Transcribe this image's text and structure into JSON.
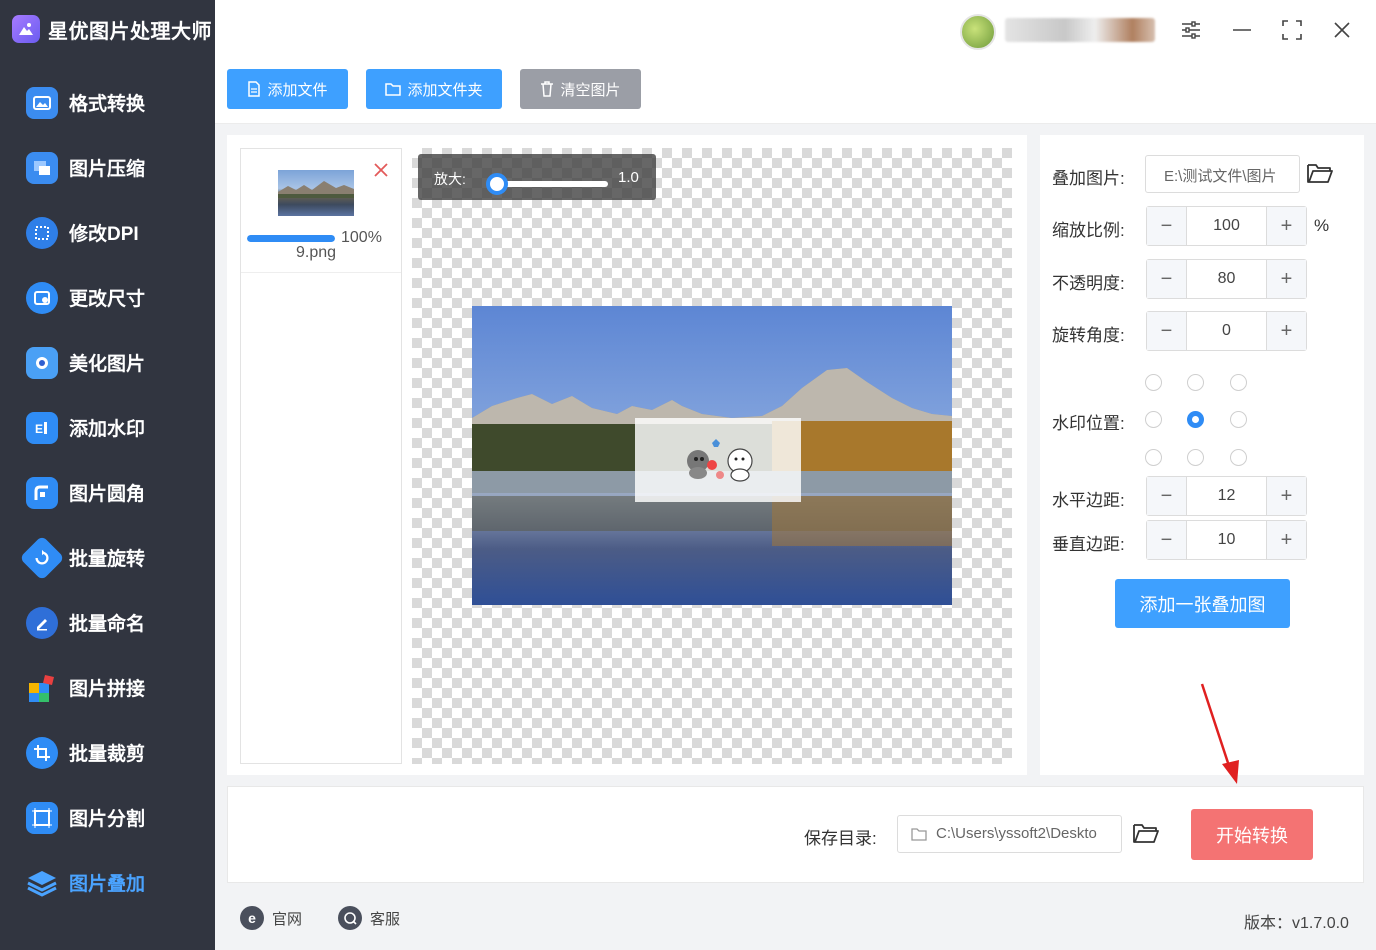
{
  "app": {
    "title": "星优图片处理大师"
  },
  "sidebar": {
    "items": [
      {
        "label": "格式转换",
        "icon": "image-convert-icon",
        "color": "#3b8cf0"
      },
      {
        "label": "图片压缩",
        "icon": "compress-icon",
        "color": "#3b8cf0"
      },
      {
        "label": "修改DPI",
        "icon": "dpi-icon",
        "color": "#2f7fe8"
      },
      {
        "label": "更改尺寸",
        "icon": "resize-icon",
        "color": "#2f8cf5"
      },
      {
        "label": "美化图片",
        "icon": "beautify-icon",
        "color": "#4aa0f5"
      },
      {
        "label": "添加水印",
        "icon": "watermark-icon",
        "color": "#2f8cf5"
      },
      {
        "label": "图片圆角",
        "icon": "round-corner-icon",
        "color": "#2f8cf5"
      },
      {
        "label": "批量旋转",
        "icon": "rotate-icon",
        "color": "#2f8cf5"
      },
      {
        "label": "批量命名",
        "icon": "rename-icon",
        "color": "#2f8cf5"
      },
      {
        "label": "图片拼接",
        "icon": "puzzle-icon",
        "color": "#2f8cf5"
      },
      {
        "label": "批量裁剪",
        "icon": "crop-icon",
        "color": "#2f8cf5"
      },
      {
        "label": "图片分割",
        "icon": "split-icon",
        "color": "#2f8cf5"
      },
      {
        "label": "图片叠加",
        "icon": "layers-icon",
        "color": "#2f8cf5",
        "active": true
      }
    ]
  },
  "toolbar": {
    "add_file": "添加文件",
    "add_folder": "添加文件夹",
    "clear_images": "清空图片"
  },
  "file": {
    "progress_text": "100%",
    "progress": 1.0,
    "name": "9.png"
  },
  "zoom": {
    "label": "放大:",
    "value": "1.0"
  },
  "settings": {
    "overlay_image_label": "叠加图片:",
    "overlay_image_path": "E:\\测试文件\\图片",
    "scale_label": "缩放比例:",
    "scale_value": "100",
    "scale_unit": "%",
    "opacity_label": "不透明度:",
    "opacity_value": "80",
    "rotation_label": "旋转角度:",
    "rotation_value": "0",
    "position_label": "水印位置:",
    "position_selected": "center",
    "h_margin_label": "水平边距:",
    "h_margin_value": "12",
    "v_margin_label": "垂直边距:",
    "v_margin_value": "10",
    "add_overlay_button": "添加一张叠加图"
  },
  "save": {
    "label": "保存目录:",
    "path": "C:\\Users\\yssoft2\\Deskto",
    "start_button": "开始转换"
  },
  "footer": {
    "website": "官网",
    "support": "客服",
    "version": "版本：v1.7.0.0"
  },
  "colors": {
    "primary": "#3ea0ff",
    "sidebar_bg": "#313540",
    "start_button": "#f47373",
    "clear_button": "#9b9ea6"
  }
}
